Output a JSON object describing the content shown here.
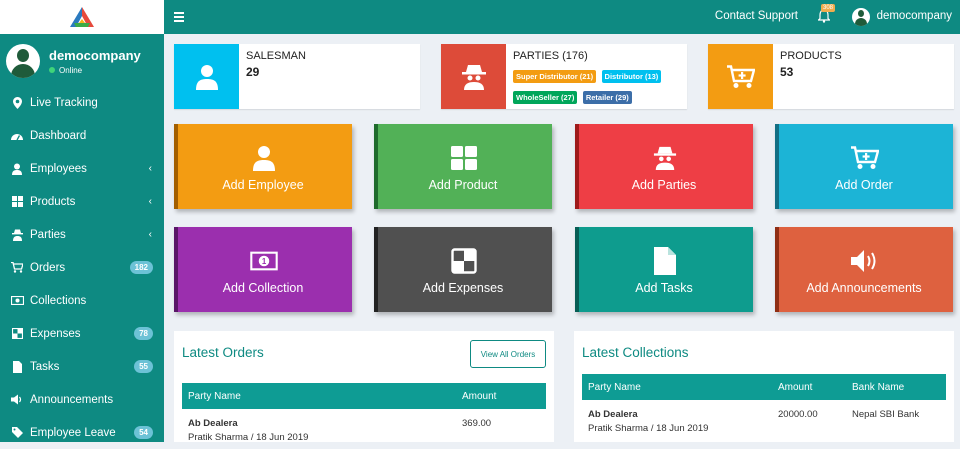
{
  "sidebar": {
    "user": {
      "name": "democompany",
      "status": "Online"
    },
    "items": [
      {
        "label": "Live Tracking",
        "icon": "map-marker-icon"
      },
      {
        "label": "Dashboard",
        "icon": "dashboard-icon"
      },
      {
        "label": "Employees",
        "icon": "user-icon",
        "chevron": true
      },
      {
        "label": "Products",
        "icon": "grid-icon",
        "chevron": true
      },
      {
        "label": "Parties",
        "icon": "spy-icon",
        "chevron": true
      },
      {
        "label": "Orders",
        "icon": "cart-icon",
        "badge": "182"
      },
      {
        "label": "Collections",
        "icon": "money-icon"
      },
      {
        "label": "Expenses",
        "icon": "expenses-icon",
        "badge": "78"
      },
      {
        "label": "Tasks",
        "icon": "file-icon",
        "badge": "55"
      },
      {
        "label": "Announcements",
        "icon": "megaphone-icon"
      },
      {
        "label": "Employee Leave",
        "icon": "tag-icon",
        "badge": "54"
      }
    ]
  },
  "header": {
    "support": "Contact Support",
    "bell_count": "308",
    "user": "democompany"
  },
  "stats": {
    "salesman": {
      "title": "SALESMAN",
      "value": "29"
    },
    "parties": {
      "title": "PARTIES (176)",
      "tags": [
        {
          "label": "Super Distributor (21)",
          "color": "#f39c12"
        },
        {
          "label": "Distributor (13)",
          "color": "#00c0ef"
        },
        {
          "label": "WholeSeller (27)",
          "color": "#00a65a"
        },
        {
          "label": "Retailer (29)",
          "color": "#3c6ea8"
        }
      ]
    },
    "products": {
      "title": "PRODUCTS",
      "value": "53"
    }
  },
  "tiles": [
    {
      "label": "Add Employee",
      "color": "#f39c12",
      "edge": "#a35f00"
    },
    {
      "label": "Add Product",
      "color": "#52b157",
      "edge": "#1f6b2c"
    },
    {
      "label": "Add Parties",
      "color": "#ee3e45",
      "edge": "#9e1a1a"
    },
    {
      "label": "Add Order",
      "color": "#1cb4d6",
      "edge": "#126f84"
    },
    {
      "label": "Add Collection",
      "color": "#9b2fae",
      "edge": "#5a1668"
    },
    {
      "label": "Add Expenses",
      "color": "#505050",
      "edge": "#222222"
    },
    {
      "label": "Add Tasks",
      "color": "#0e9c8e",
      "edge": "#075e55"
    },
    {
      "label": "Add Announcements",
      "color": "#de613f",
      "edge": "#8f2e14"
    }
  ],
  "orders": {
    "title": "Latest Orders",
    "view_all": "View All Orders",
    "columns": [
      "Party Name",
      "Amount"
    ],
    "rows": [
      {
        "party": "Ab Dealera",
        "sub": "Pratik Sharma / 18 Jun 2019",
        "amount": "369.00"
      }
    ]
  },
  "collections": {
    "title": "Latest Collections",
    "columns": [
      "Party Name",
      "Amount",
      "Bank Name"
    ],
    "rows": [
      {
        "party": "Ab Dealera",
        "sub": "Pratik Sharma / 18 Jun 2019",
        "amount": "20000.00",
        "bank": "Nepal SBI Bank"
      }
    ]
  }
}
